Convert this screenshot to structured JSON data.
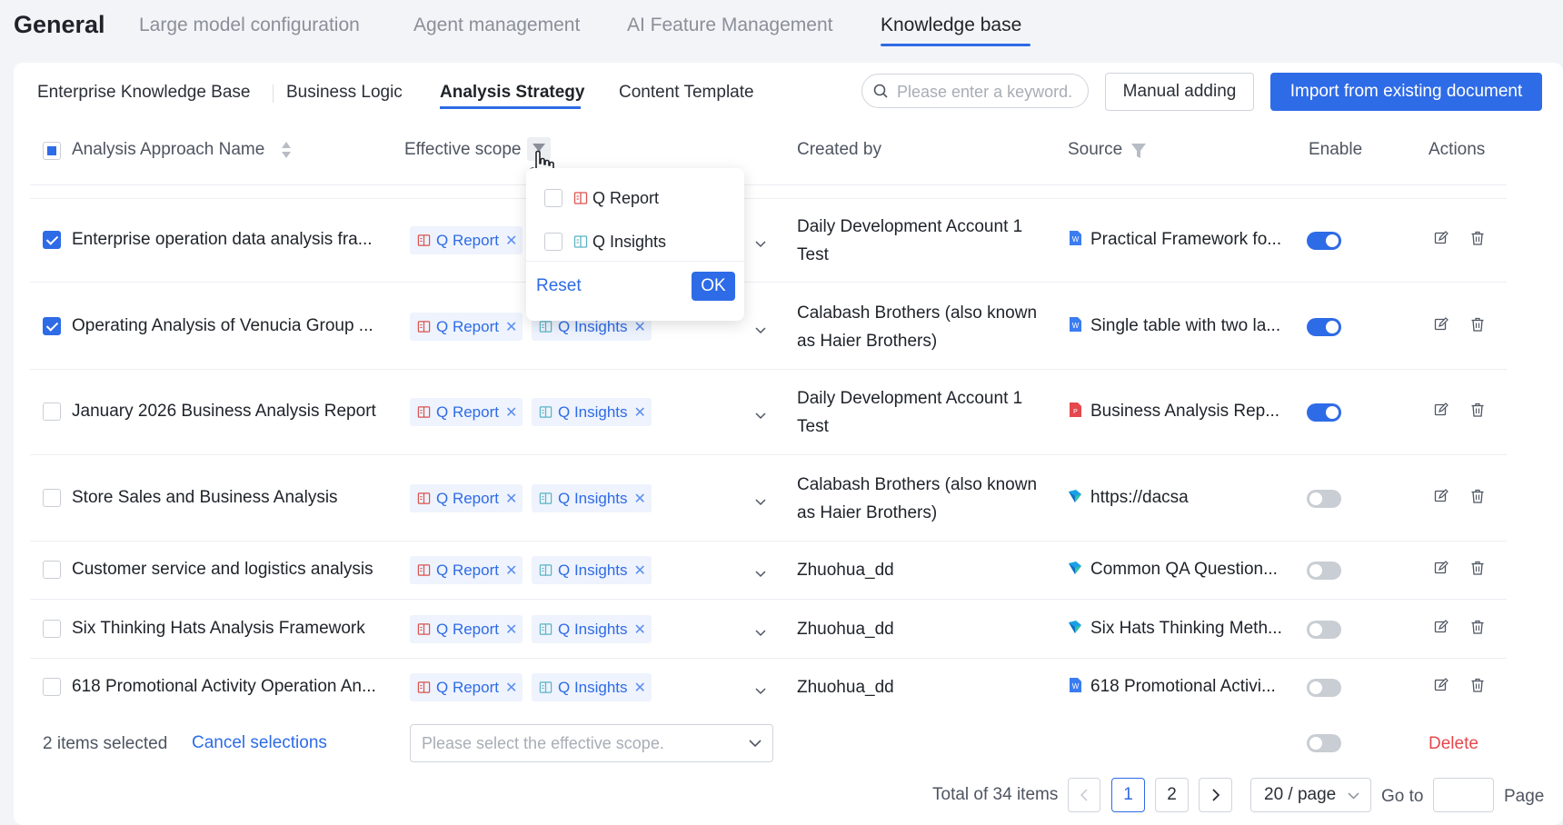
{
  "top_nav": {
    "brand": "General",
    "tabs": [
      "Large model configuration",
      "Agent management",
      "AI Feature Management",
      "Knowledge base"
    ],
    "active_tab": "Knowledge base"
  },
  "sub_tabs": {
    "items": [
      "Enterprise Knowledge Base",
      "Business Logic",
      "Analysis Strategy",
      "Content Template"
    ],
    "active": "Analysis Strategy"
  },
  "toolbar": {
    "search_placeholder": "Please enter a keyword.",
    "manual_adding": "Manual adding",
    "import_button": "Import from existing document"
  },
  "table": {
    "columns": {
      "name": "Analysis Approach Name",
      "scope": "Effective scope",
      "created_by": "Created by",
      "source": "Source",
      "enable": "Enable",
      "actions": "Actions"
    },
    "tags": {
      "report": "Q Report",
      "insights": "Q Insights"
    },
    "rows": [
      {
        "name": "Enterprise operation data analysis fra...",
        "checked": true,
        "tags": [
          "Q Report"
        ],
        "created_by": "Daily Development Account 1 Test",
        "source_icon": "word-doc-icon",
        "source": "Practical Framework fo...",
        "enabled": true
      },
      {
        "name": "Operating Analysis of Venucia Group ...",
        "checked": true,
        "tags": [
          "Q Report",
          "Q Insights"
        ],
        "created_by": "Calabash Brothers (also known as Haier Brothers)",
        "source_icon": "word-doc-icon",
        "source": "Single table with two la...",
        "enabled": true
      },
      {
        "name": "January 2026 Business Analysis Report",
        "checked": false,
        "tags": [
          "Q Report",
          "Q Insights"
        ],
        "created_by": "Daily Development Account 1 Test",
        "source_icon": "pdf-icon",
        "source": "Business Analysis Rep...",
        "enabled": true
      },
      {
        "name": "Store Sales and Business Analysis",
        "checked": false,
        "tags": [
          "Q Report",
          "Q Insights"
        ],
        "created_by": "Calabash Brothers (also known as Haier Brothers)",
        "source_icon": "link-icon",
        "source": "https://dacsa",
        "enabled": false
      },
      {
        "name": "Customer service and logistics analysis",
        "checked": false,
        "tags": [
          "Q Report",
          "Q Insights"
        ],
        "created_by": "Zhuohua_dd",
        "source_icon": "link-icon",
        "source": "Common QA Question...",
        "enabled": false
      },
      {
        "name": "Six Thinking Hats Analysis Framework",
        "checked": false,
        "tags": [
          "Q Report",
          "Q Insights"
        ],
        "created_by": "Zhuohua_dd",
        "source_icon": "link-icon",
        "source": "Six Hats Thinking Meth...",
        "enabled": false
      },
      {
        "name": "618 Promotional Activity Operation An...",
        "checked": false,
        "tags": [
          "Q Report",
          "Q Insights"
        ],
        "created_by": "Zhuohua_dd",
        "source_icon": "word-doc-icon",
        "source": "618 Promotional Activi...",
        "enabled": false
      }
    ]
  },
  "filter_dropdown": {
    "options": [
      "Q Report",
      "Q Insights"
    ],
    "reset": "Reset",
    "ok": "OK"
  },
  "batch_bar": {
    "selected_text": "2 items selected",
    "cancel": "Cancel selections",
    "scope_placeholder": "Please select the effective scope.",
    "delete": "Delete"
  },
  "pagination": {
    "total": "Total of 34 items",
    "pages": [
      "1",
      "2"
    ],
    "current": "1",
    "page_size": "20 / page",
    "goto": "Go to",
    "page_suffix": "Page"
  },
  "colors": {
    "accent": "#2e6be6",
    "danger": "#e5484d",
    "tag_bg": "#eef3fd"
  }
}
